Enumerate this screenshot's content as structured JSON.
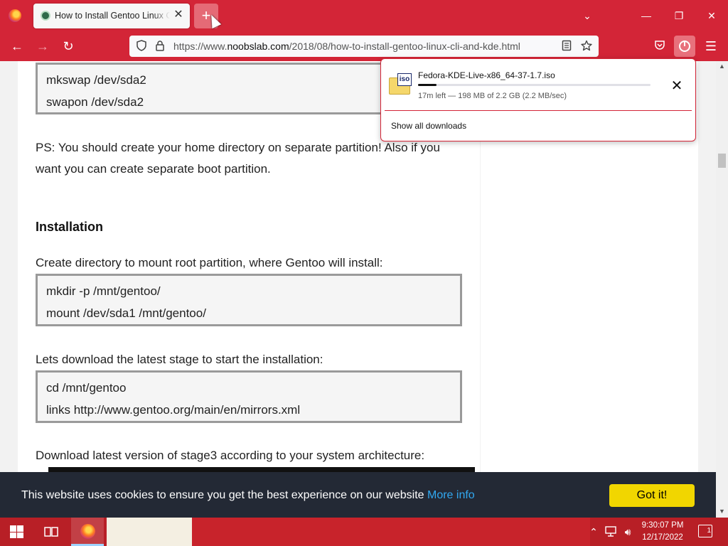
{
  "browser": {
    "tab_title": "How to Install Gentoo Linux CLI",
    "tab_close_glyph": "✕",
    "new_tab_glyph": "+",
    "url_host_prefix": "https://www.",
    "url_host": "noobslab.com",
    "url_path": "/2018/08/how-to-install-gentoo-linux-cli-and-kde.html",
    "window_controls": {
      "list_tabs": "⌄",
      "minimize": "—",
      "restore": "❐",
      "close": "✕"
    },
    "nav": {
      "back": "←",
      "forward": "→",
      "reload": "↻",
      "menu": "☰"
    }
  },
  "download_panel": {
    "file_name": "Fedora-KDE-Live-x86_64-37-1.7.iso",
    "icon_label": "iso",
    "progress": 0.08,
    "status": "17m left — 198 MB of 2.2 GB (2.2 MB/sec)",
    "cancel_glyph": "✕",
    "show_all": "Show all downloads"
  },
  "article": {
    "code1": [
      "mkswap /dev/sda2",
      "swapon /dev/sda2"
    ],
    "ps_text": "PS: You should create your home directory on separate partition! Also if you want you can create separate boot partition.",
    "heading_installation": "Installation",
    "mount_intro": "Create directory to mount root partition, where Gentoo will install:",
    "code2": [
      "mkdir -p /mnt/gentoo/",
      "mount /dev/sda1 /mnt/gentoo/"
    ],
    "stage_intro": "Lets download the latest stage to start the installation:",
    "code3": [
      "cd /mnt/gentoo",
      "links http://www.gentoo.org/main/en/mirrors.xml"
    ],
    "stage3_intro": "Download latest version of stage3 according to your system architecture:"
  },
  "cookie_banner": {
    "text": "This website uses cookies to ensure you get the best experience on our website",
    "link": "More info",
    "button": "Got it!"
  },
  "taskbar": {
    "time": "9:30:07 PM",
    "date": "12/17/2022",
    "notifications": "1"
  },
  "colors": {
    "browser_chrome": "#d32537",
    "cookie_bg": "#232935",
    "cookie_button": "#f1d600",
    "cookie_link": "#31a8f0"
  }
}
